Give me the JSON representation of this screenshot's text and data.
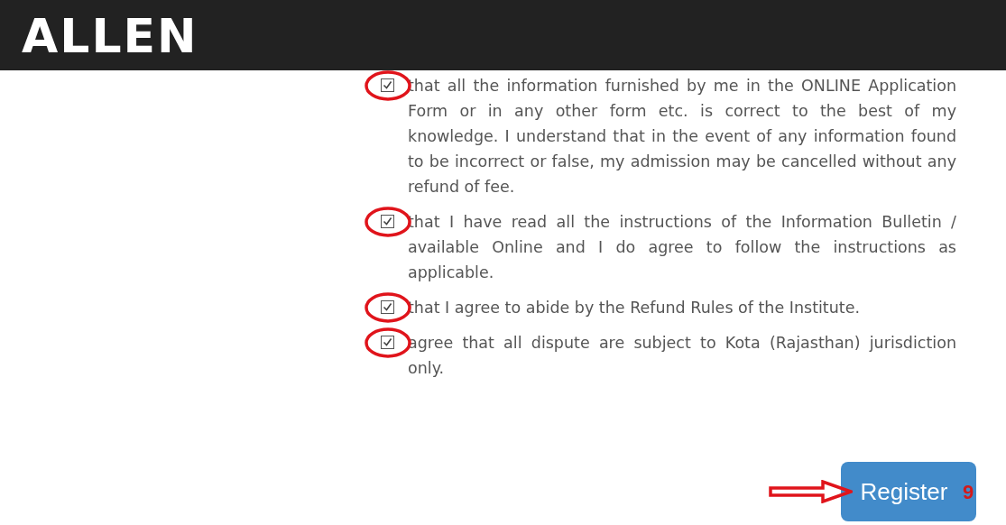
{
  "header": {
    "logo": "ALLEN"
  },
  "declarations": [
    {
      "text": "that all the information furnished by me in the ONLINE Application Form or in any other form etc. is correct to the best of my knowledge. I understand that in the event of any information found to be incorrect or false, my admission may be cancelled without any refund of fee.",
      "checked": true,
      "circled": true
    },
    {
      "text": "that I have read all the instructions of the Information Bulletin / available Online and I do agree to follow the instructions as applicable.",
      "checked": true,
      "circled": true
    },
    {
      "text": "that I agree to abide by the Refund Rules of the Institute.",
      "checked": true,
      "circled": true
    },
    {
      "text": "agree that all dispute are subject to Kota (Rajasthan) jurisdiction only.",
      "checked": true,
      "circled": true
    }
  ],
  "register_button": {
    "label": "Register",
    "annotation": {
      "step": "9",
      "arrow": true
    }
  }
}
